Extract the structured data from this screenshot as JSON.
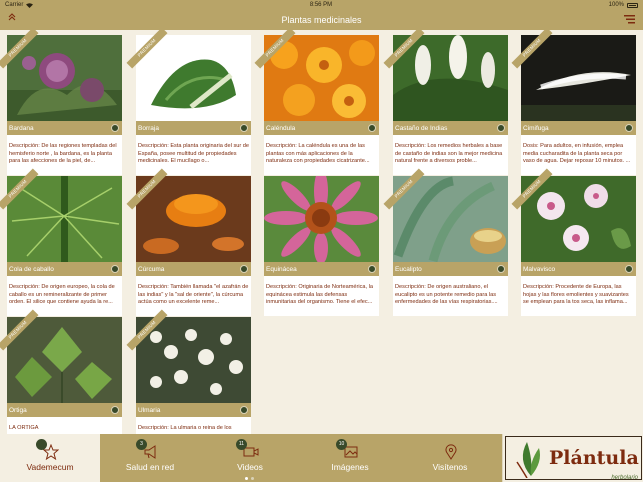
{
  "status": {
    "carrier": "Carrier",
    "time": "8:56 PM",
    "battery": "100%"
  },
  "nav": {
    "title": "Plantas medicinales"
  },
  "badge_text": "PREMIUM",
  "cards": [
    {
      "name": "Bardana",
      "desc": "Descripción: De las regiones templadas del hemisferio norte , la bardana, es la planta para las afecciones de la piel, de...",
      "premium": true
    },
    {
      "name": "Borraja",
      "desc": "Descripción: Esta planta originaria del sur de España, posee multitud de propiedades medicinales. El mucílago o...",
      "premium": true
    },
    {
      "name": "Caléndula",
      "desc": "Descripción: La caléndula es una de las plantas con más aplicaciones de la naturaleza con propiedades cicatrizante...",
      "premium": true
    },
    {
      "name": "Castaño de Indias",
      "desc": "Descripción: Los remedios herbales a base de castaño de indias son la mejor medicina natural frente a diversos proble...",
      "premium": true
    },
    {
      "name": "Cimifuga",
      "desc": "Dosis: Para adultos, en infusión, emplea media cucharadita de la planta seca por vaso de agua. Dejar reposar 10 minutos. ...",
      "premium": true
    },
    {
      "name": "Cola de caballo",
      "desc": "Descripción: De origen europeo, la cola de caballo es un remineralizante de primer orden. El silice que contiene ayuda la re...",
      "premium": true
    },
    {
      "name": "Cúrcuma",
      "desc": "Descripción: También llamada \"el azafrán de las indias\" y la \"sal de oriente\", la cúrcuma actúa como un excelente reme...",
      "premium": true
    },
    {
      "name": "Equinácea",
      "desc": "Descripción: Originaria de Norteamérica, la equinácea estimula las defensas inmunitarias del organismo. Tiene el efec...",
      "premium": false
    },
    {
      "name": "Eucalipto",
      "desc": "Descripción: De origen australiano, el eucalipto es un potente remedio para las enfermedades de las vías respiratorias....",
      "premium": true
    },
    {
      "name": "Malvavisco",
      "desc": "Descripción: Procedente de Europa, las hojas y las flores emolientes y suavizantes se emplean para la tos seca, las inflama...",
      "premium": true
    },
    {
      "name": "Ortiga",
      "desc": "LA ORTIGA",
      "premium": true
    },
    {
      "name": "Ulmaria",
      "desc": "Descripción: La ulmaria o reina de los",
      "premium": true
    }
  ],
  "tabs": [
    {
      "label": "Vademecum",
      "badge": "",
      "icon": "star-icon"
    },
    {
      "label": "Salud en red",
      "badge": "3",
      "icon": "megaphone-icon"
    },
    {
      "label": "Videos",
      "badge": "11",
      "icon": "video-camera-icon"
    },
    {
      "label": "Imágenes",
      "badge": "10",
      "icon": "gallery-icon"
    },
    {
      "label": "Visítenos",
      "badge": "",
      "icon": "location-pin-icon"
    }
  ],
  "logo": {
    "word": "Plántula",
    "sub": "herbolario"
  },
  "colors": {
    "bar": "#b8a468",
    "accent": "#7d2b0f",
    "background": "#f4efe2",
    "dot": "#384a2a"
  }
}
